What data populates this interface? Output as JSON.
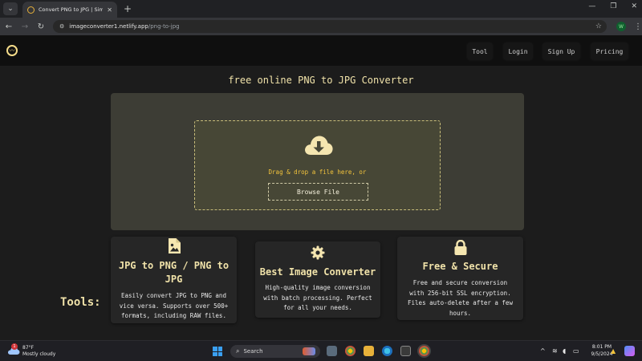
{
  "browser": {
    "tab_title": "Convert PNG to JPG | Simple Im",
    "url_domain": "imageconverter1.netlify.app",
    "url_path": "/png-to-jpg",
    "profile_initial": "W"
  },
  "nav": {
    "items": [
      "Tool",
      "Login",
      "Sign Up",
      "Pricing"
    ]
  },
  "main": {
    "heading": "free online PNG to JPG Converter",
    "drop_text": "Drag & drop a file here, or",
    "browse_label": "Browse File"
  },
  "cards": [
    {
      "icon": "image-file-icon",
      "title": "JPG to PNG / PNG to JPG",
      "description": "Easily convert JPG to PNG and vice versa. Supports over 500+ formats, including RAW files."
    },
    {
      "icon": "gear-icon",
      "title": "Best Image Converter",
      "description": "High-quality image conversion with batch processing. Perfect for all your needs."
    },
    {
      "icon": "lock-icon",
      "title": "Free & Secure",
      "description": "Free and secure conversion with 256-bit SSL encryption. Files auto-delete after a few hours."
    }
  ],
  "tools_heading": "Tools:",
  "taskbar": {
    "temperature": "87°F",
    "condition": "Mostly cloudy",
    "weather_badge": "1",
    "search_label": "Search",
    "time": "8:01 PM",
    "date": "9/5/2024"
  },
  "colors": {
    "accent": "#f0e2a9",
    "drop_text": "#f2c33c",
    "upload_bg": "#3d3d35"
  }
}
